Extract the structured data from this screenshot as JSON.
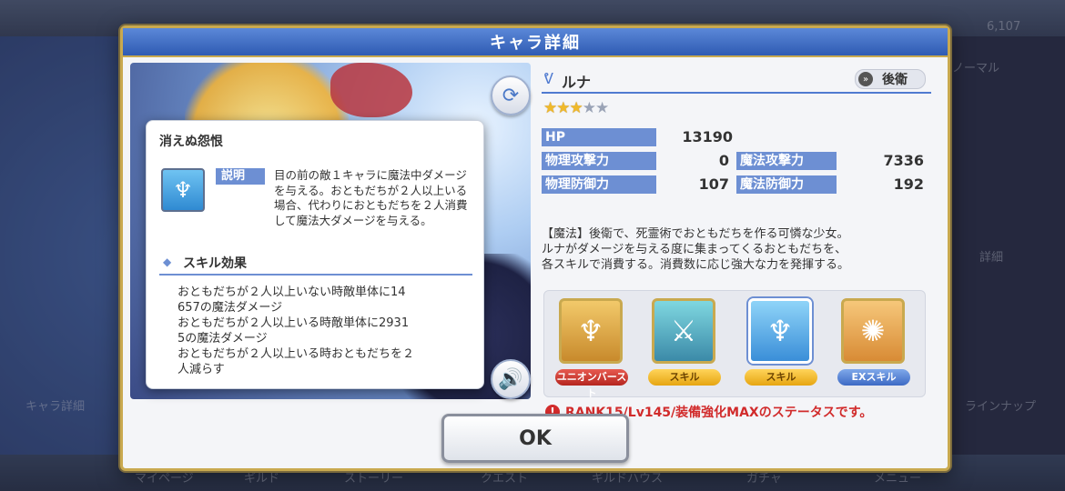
{
  "background": {
    "nav_items": [
      "マイページ",
      "ギルド",
      "ストーリー",
      "クエスト",
      "ギルドハウス",
      "ガチャ",
      "メニュー"
    ],
    "right_labels": [
      "ノーマル",
      "詳細",
      "ラインナップ",
      "6,107"
    ],
    "left_button": "キャラ詳細"
  },
  "dialog": {
    "title": "キャラ詳細",
    "ok_label": "OK"
  },
  "character": {
    "name": "ルナ",
    "position": "後衛",
    "stars_filled": 3,
    "stars_total": 5,
    "stats": {
      "hp_label": "HP",
      "hp_value": "13190",
      "patk_label": "物理攻撃力",
      "patk_value": "0",
      "matk_label": "魔法攻撃力",
      "matk_value": "7336",
      "pdef_label": "物理防御力",
      "pdef_value": "107",
      "mdef_label": "魔法防御力",
      "mdef_value": "192"
    },
    "description": "【魔法】後衛で、死霊術でおともだちを作る可憐な少女。\nルナがダメージを与える度に集まってくるおともだちを、\n各スキルで消費する。消費数に応じ強大な力を発揮する。",
    "skills": [
      {
        "label": "ユニオンバースト",
        "icon": "union-burst-icon",
        "color": "red"
      },
      {
        "label": "スキル",
        "icon": "skill-icon",
        "color": "yellow"
      },
      {
        "label": "スキル",
        "icon": "skill-icon",
        "color": "yellow"
      },
      {
        "label": "EXスキル",
        "icon": "ex-skill-icon",
        "color": "blue"
      }
    ],
    "rank_note": "RANK15/Lv145/装備強化MAXのステータスです。"
  },
  "popup": {
    "skill_name": "消えぬ怨恨",
    "tag": "説明",
    "description": "目の前の敵１キャラに魔法中ダメージを与える。おともだちが２人以上いる場合、代わりにおともだちを２人消費して魔法大ダメージを与える。",
    "effects_heading": "スキル効果",
    "effects": [
      "おともだちが２人以上いない時敵単体に14",
      "657の魔法ダメージ",
      "おともだちが２人以上いる時敵単体に2931",
      "5の魔法ダメージ",
      "おともだちが２人以上いる時おともだちを２",
      "人減らす"
    ]
  }
}
